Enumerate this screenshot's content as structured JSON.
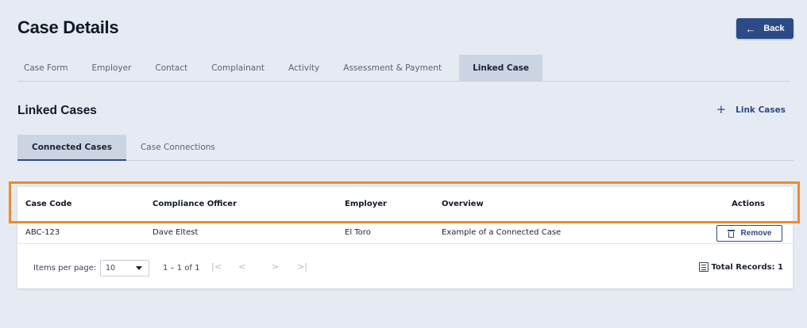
{
  "page": {
    "title": "Case Details",
    "back_label": "Back"
  },
  "tabs": [
    {
      "label": "Case Form"
    },
    {
      "label": "Employer"
    },
    {
      "label": "Contact"
    },
    {
      "label": "Complainant"
    },
    {
      "label": "Activity"
    },
    {
      "label": "Assessment & Payment"
    },
    {
      "label": "Linked Case",
      "active": true
    }
  ],
  "section": {
    "title": "Linked Cases",
    "link_cases_label": "Link Cases"
  },
  "subtabs": [
    {
      "label": "Connected Cases",
      "active": true
    },
    {
      "label": "Case Connections"
    }
  ],
  "table": {
    "columns": [
      "Case Code",
      "Compliance Officer",
      "Employer",
      "Overview",
      "Actions"
    ],
    "rows": [
      {
        "case_code": "ABC-123",
        "compliance_officer": "Dave Eltest",
        "employer": "El Toro",
        "overview": "Example of a Connected Case",
        "action_label": "Remove"
      }
    ]
  },
  "pagination": {
    "items_per_page_label": "Items per page:",
    "items_per_page_value": "10",
    "range": "1 – 1 of 1",
    "first": "|<",
    "prev": "<",
    "next": ">",
    "last": ">|",
    "total_records": "Total Records: 1"
  },
  "colors": {
    "accent": "#2c4a86",
    "highlight": "#ef8a2c",
    "background": "#e6ebf3",
    "active_tab": "#ccd4e3"
  },
  "icons": [
    "arrow-left-icon",
    "plus-icon",
    "trash-icon",
    "chevron-down-icon",
    "list-icon"
  ]
}
